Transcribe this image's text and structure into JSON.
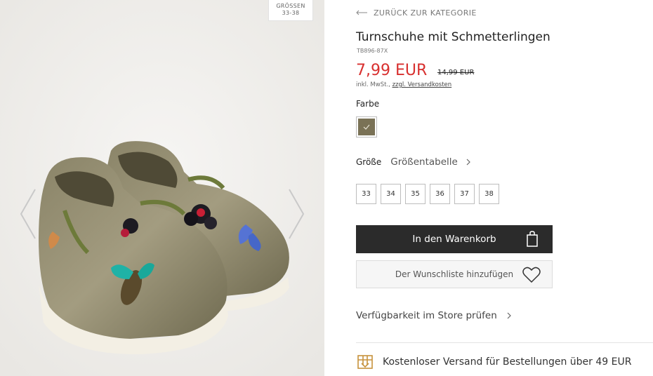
{
  "gallery": {
    "size_badge_line1": "GRÖSSEN",
    "size_badge_line2": "33-38"
  },
  "product": {
    "back_label": "ZURÜCK ZUR KATEGORIE",
    "title": "Turnschuhe mit Schmetterlingen",
    "sku": "TB896-87X",
    "price": "7,99 EUR",
    "old_price": "14,99 EUR",
    "tax_prefix": "inkl. MwSt., ",
    "shipping_link": "zzgl. Versandkosten",
    "color_label": "Farbe",
    "selected_color": "#7a7256",
    "size_label": "Größe",
    "size_chart_label": "Größentabelle",
    "sizes": [
      "33",
      "34",
      "35",
      "36",
      "37",
      "38"
    ],
    "add_to_cart_label": "In den Warenkorb",
    "wishlist_label": "Der Wunschliste hinzufügen",
    "store_check_label": "Verfügbarkeit im Store prüfen",
    "free_shipping_label": "Kostenloser Versand für Bestellungen über 49 EUR"
  },
  "colors": {
    "price_red": "#d8302f",
    "button_dark": "#2b2b2b",
    "shipping_icon": "#c7923c"
  }
}
